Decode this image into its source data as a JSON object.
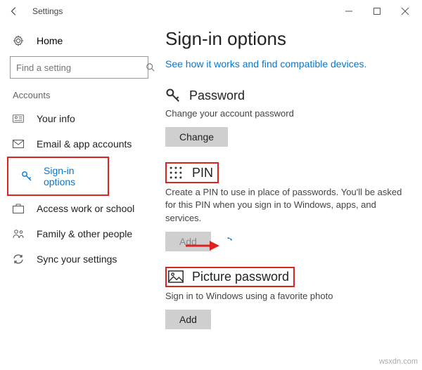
{
  "window": {
    "title": "Settings"
  },
  "sidebar": {
    "home": "Home",
    "searchPlaceholder": "Find a setting",
    "group": "Accounts",
    "items": [
      {
        "label": "Your info"
      },
      {
        "label": "Email & app accounts"
      },
      {
        "label": "Sign-in options"
      },
      {
        "label": "Access work or school"
      },
      {
        "label": "Family & other people"
      },
      {
        "label": "Sync your settings"
      }
    ]
  },
  "content": {
    "heading": "Sign-in options",
    "link": "See how it works and find compatible devices.",
    "password": {
      "title": "Password",
      "desc": "Change your account password",
      "button": "Change"
    },
    "pin": {
      "title": "PIN",
      "desc": "Create a PIN to use in place of passwords. You'll be asked for this PIN when you sign in to Windows, apps, and services.",
      "button": "Add"
    },
    "picture": {
      "title": "Picture password",
      "desc": "Sign in to Windows using a favorite photo",
      "button": "Add"
    }
  },
  "watermark": "wsxdn.com"
}
